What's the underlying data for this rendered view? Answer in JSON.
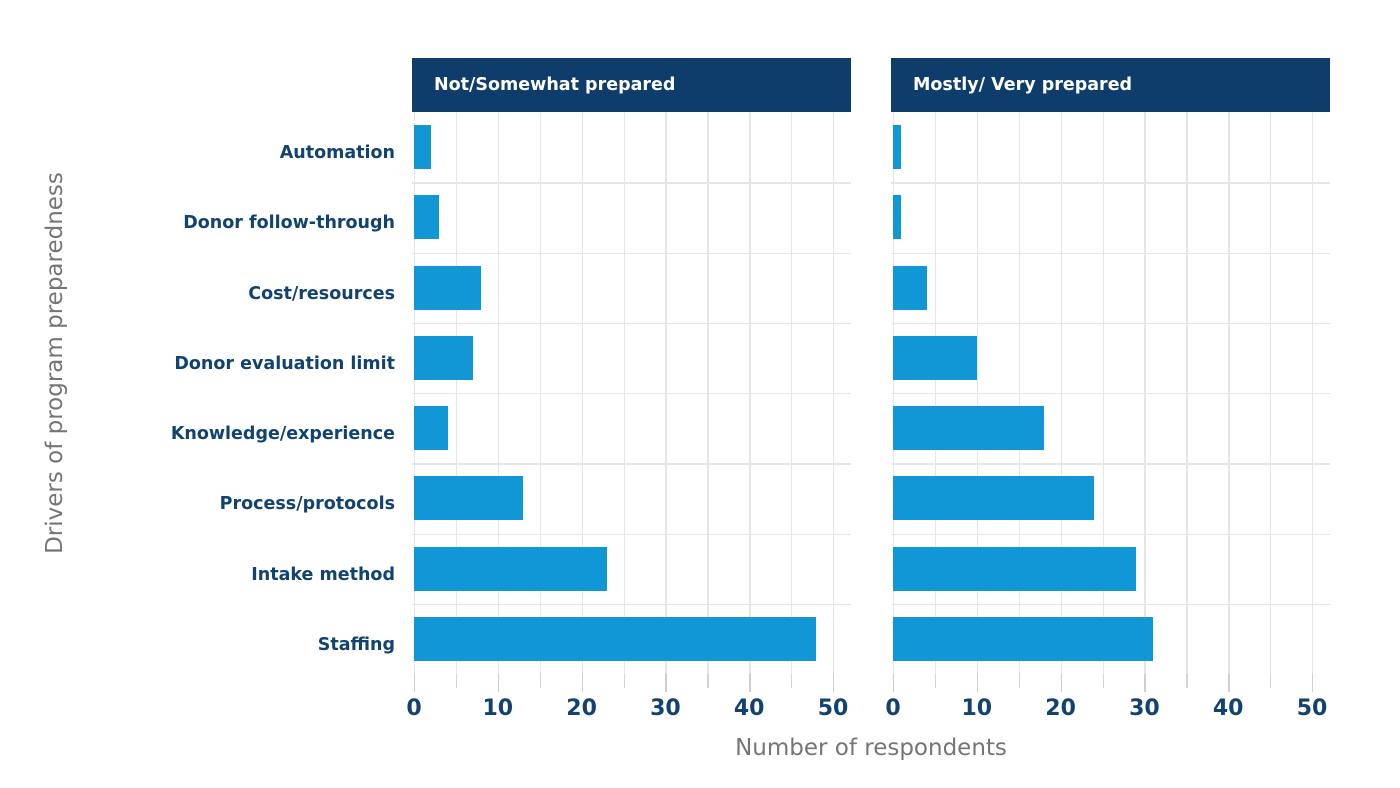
{
  "chart_data": {
    "type": "bar",
    "orientation": "horizontal",
    "title": "",
    "subtitle": "",
    "xlabel": "Number of respondents",
    "ylabel": "Drivers of program preparedness",
    "xlim": [
      0,
      50
    ],
    "xticks": [
      0,
      10,
      20,
      30,
      40,
      50
    ],
    "xtick_labels": [
      "0",
      "10",
      "20",
      "30",
      "40",
      "50"
    ],
    "minor_tick_step": 5,
    "grid": true,
    "grid_axis": "both",
    "legend": "none",
    "facets": [
      "Not/Somewhat prepared",
      "Mostly/ Very prepared"
    ],
    "categories": [
      "Automation",
      "Donor follow-through",
      "Cost/resources",
      "Donor evaluation limit",
      "Knowledge/experience",
      "Process/protocols",
      "Intake method",
      "Staffing"
    ],
    "series": [
      {
        "name": "Not/Somewhat prepared",
        "values": [
          2,
          3,
          8,
          7,
          4,
          13,
          23,
          48
        ]
      },
      {
        "name": "Mostly/ Very prepared",
        "values": [
          1,
          1,
          4,
          10,
          18,
          24,
          29,
          31
        ]
      }
    ],
    "colors": {
      "bar": "#1197d5",
      "panel_header_bg": "#0e3c6b",
      "panel_header_text": "#ffffff",
      "tick_label": "#124370",
      "category_label": "#124370",
      "axis_title": "#757575",
      "gridline": "#e6e6e6",
      "background": "#ffffff"
    }
  },
  "panels": [
    {
      "header_label": "Not/Somewhat prepared",
      "values": [
        2,
        3,
        8,
        7,
        4,
        13,
        23,
        48
      ]
    },
    {
      "header_label": "Mostly/ Very prepared",
      "values": [
        1,
        1,
        4,
        10,
        18,
        24,
        29,
        31
      ]
    }
  ],
  "axes": {
    "y_title": "Drivers of program preparedness",
    "x_title": "Number of respondents",
    "x_tick_labels": [
      "0",
      "10",
      "20",
      "30",
      "40",
      "50"
    ],
    "category_labels": [
      "Automation",
      "Donor follow-through",
      "Cost/resources",
      "Donor evaluation limit",
      "Knowledge/experience",
      "Process/protocols",
      "Intake method",
      "Staffing"
    ]
  }
}
